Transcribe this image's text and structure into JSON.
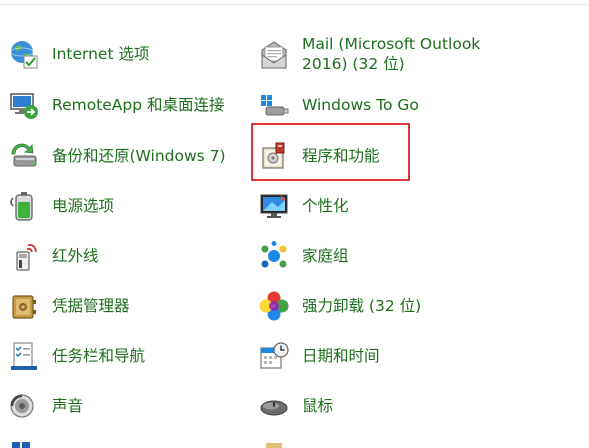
{
  "left_items": [
    {
      "label": "Internet 选项",
      "icon": "globe-check-icon"
    },
    {
      "label": "RemoteApp 和桌面连接",
      "icon": "remote-desktop-icon"
    },
    {
      "label": "备份和还原(Windows 7)",
      "icon": "backup-restore-icon"
    },
    {
      "label": "电源选项",
      "icon": "battery-power-icon"
    },
    {
      "label": "红外线",
      "icon": "infrared-icon"
    },
    {
      "label": "凭据管理器",
      "icon": "credential-vault-icon"
    },
    {
      "label": "任务栏和导航",
      "icon": "taskbar-checklist-icon"
    },
    {
      "label": "声音",
      "icon": "speaker-icon"
    }
  ],
  "right_items": [
    {
      "label": "Mail (Microsoft Outlook 2016) (32 位)",
      "icon": "mail-outlook-icon"
    },
    {
      "label": "Windows To Go",
      "icon": "usb-drive-icon"
    },
    {
      "label": "程序和功能",
      "icon": "programs-features-icon"
    },
    {
      "label": "个性化",
      "icon": "personalization-monitor-icon"
    },
    {
      "label": "家庭组",
      "icon": "homegroup-icon"
    },
    {
      "label": "强力卸载 (32 位)",
      "icon": "colorful-flower-icon"
    },
    {
      "label": "日期和时间",
      "icon": "calendar-clock-icon"
    },
    {
      "label": "鼠标",
      "icon": "mouse-icon"
    }
  ],
  "highlighted_item": "程序和功能",
  "colors": {
    "label_green": "#1d6e1d",
    "highlight_red": "#e03434"
  }
}
